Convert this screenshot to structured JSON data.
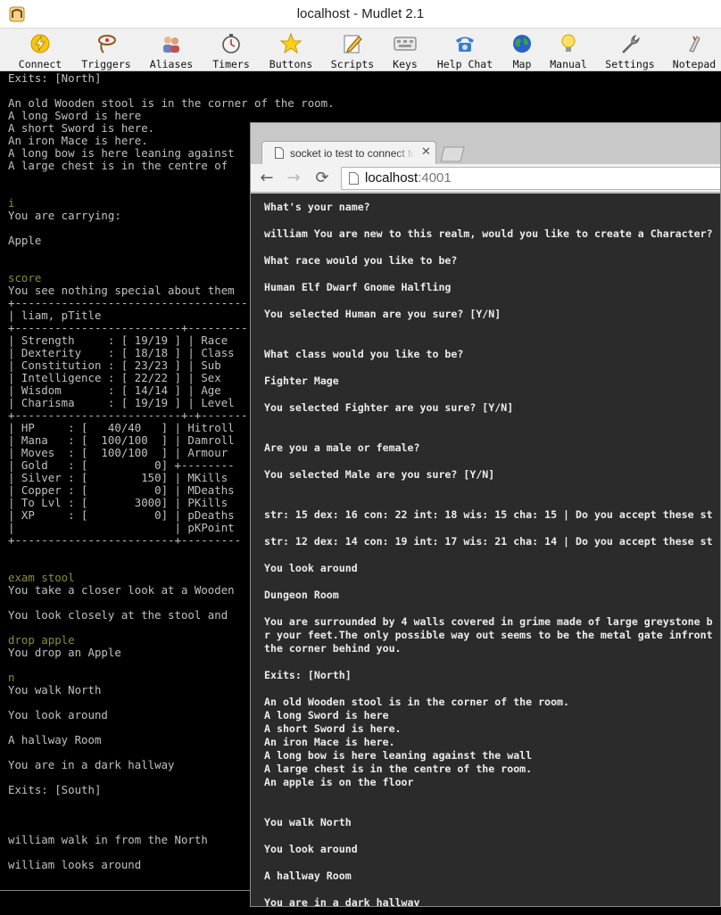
{
  "window": {
    "title": "localhost - Mudlet 2.1"
  },
  "toolbar": {
    "items": [
      {
        "label": "Connect",
        "icon": "lightning-icon"
      },
      {
        "label": "Triggers",
        "icon": "lasso-icon"
      },
      {
        "label": "Aliases",
        "icon": "people-icon"
      },
      {
        "label": "Timers",
        "icon": "stopwatch-icon"
      },
      {
        "label": "Buttons",
        "icon": "star-icon"
      },
      {
        "label": "Scripts",
        "icon": "pencil-icon"
      },
      {
        "label": "Keys",
        "icon": "keyboard-icon"
      },
      {
        "label": "Help Chat",
        "icon": "telephone-icon"
      },
      {
        "label": "Map",
        "icon": "globe-icon"
      },
      {
        "label": "Manual",
        "icon": "lightbulb-icon"
      },
      {
        "label": "Settings",
        "icon": "wrench-icon"
      },
      {
        "label": "Notepad",
        "icon": "notepad-icon"
      }
    ]
  },
  "console": {
    "lines": [
      {
        "text": "Exits: [North]",
        "kind": "out"
      },
      {
        "text": "An old Wooden stool is in the corner of the room.",
        "kind": "out"
      },
      {
        "text": "A long Sword is here",
        "kind": "out"
      },
      {
        "text": "A short Sword is here.",
        "kind": "out"
      },
      {
        "text": "An iron Mace is here.",
        "kind": "out"
      },
      {
        "text": "A long bow is here leaning against",
        "kind": "out"
      },
      {
        "text": "A large chest is in the centre of",
        "kind": "out"
      },
      {
        "text": "i",
        "kind": "cmd"
      },
      {
        "text": "You are carrying:",
        "kind": "out"
      },
      {
        "text": "Apple",
        "kind": "out"
      },
      {
        "text": "score",
        "kind": "cmd"
      },
      {
        "text": "You see nothing special about them",
        "kind": "out"
      },
      {
        "text": "+-----------------------------------",
        "kind": "out"
      },
      {
        "text": "| liam, pTitle",
        "kind": "out"
      },
      {
        "text": "+-------------------------+---------",
        "kind": "out"
      },
      {
        "text": "| Strength     : [ 19/19 ] | Race",
        "kind": "out"
      },
      {
        "text": "| Dexterity    : [ 18/18 ] | Class",
        "kind": "out"
      },
      {
        "text": "| Constitution : [ 23/23 ] | Sub",
        "kind": "out"
      },
      {
        "text": "| Intelligence : [ 22/22 ] | Sex",
        "kind": "out"
      },
      {
        "text": "| Wisdom       : [ 14/14 ] | Age",
        "kind": "out"
      },
      {
        "text": "| Charisma     : [ 19/19 ] | Level",
        "kind": "out"
      },
      {
        "text": "+-------------------------+-+-------",
        "kind": "out"
      },
      {
        "text": "| HP     : [   40/40   ] | Hitroll",
        "kind": "out"
      },
      {
        "text": "| Mana   : [  100/100  ] | Damroll",
        "kind": "out"
      },
      {
        "text": "| Moves  : [  100/100  ] | Armour",
        "kind": "out"
      },
      {
        "text": "| Gold   : [          0] +--------",
        "kind": "out"
      },
      {
        "text": "| Silver : [        150] | MKills",
        "kind": "out"
      },
      {
        "text": "| Copper : [          0] | MDeaths",
        "kind": "out"
      },
      {
        "text": "| To Lvl : [       3000] | PKills",
        "kind": "out"
      },
      {
        "text": "| XP     : [          0] | pDeaths",
        "kind": "out"
      },
      {
        "text": "|                        | pKPoint",
        "kind": "out"
      },
      {
        "text": "+------------------------+---------",
        "kind": "out"
      },
      {
        "text": "exam stool",
        "kind": "cmd"
      },
      {
        "text": "You take a closer look at a Wooden",
        "kind": "out"
      },
      {
        "text": "You look closely at the stool and",
        "kind": "out"
      },
      {
        "text": "drop apple",
        "kind": "cmd"
      },
      {
        "text": "You drop an Apple",
        "kind": "out"
      },
      {
        "text": "n",
        "kind": "cmd"
      },
      {
        "text": "You walk North",
        "kind": "out"
      },
      {
        "text": "You look around",
        "kind": "out"
      },
      {
        "text": "A hallway Room",
        "kind": "out"
      },
      {
        "text": "You are in a dark hallway",
        "kind": "out"
      },
      {
        "text": "Exits: [South]",
        "kind": "out"
      },
      {
        "text": "william walk in from the North",
        "kind": "out"
      },
      {
        "text": "william looks around",
        "kind": "out"
      }
    ]
  },
  "browser": {
    "tab_title": "socket io test to connect to",
    "tab_close": "✕",
    "url_host": "localhost",
    "url_port": ":4001",
    "back": "←",
    "forward": "→",
    "reload": "⟳",
    "page_lines": [
      "What's your name?",
      "william You are new to this realm, would you like to create a Character?",
      "What race would you like to be?",
      "Human Elf Dwarf Gnome Halfling",
      "You selected Human are you sure? [Y/N]",
      "What class would you like to be?",
      "Fighter Mage",
      "You selected Fighter are you sure? [Y/N]",
      "Are you a male or female?",
      "You selected Male are you sure? [Y/N]",
      "str: 15 dex: 16 con: 22 int: 18 wis: 15 cha: 15 | Do you accept these st",
      "str: 12 dex: 14 con: 19 int: 17 wis: 21 cha: 14 | Do you accept these st",
      "You look around",
      "Dungeon Room",
      "You are surrounded by 4 walls covered in grime made of large greystone b",
      "r your feet.The only possible way out seems to be the metal gate infront",
      "the corner behind you.",
      "Exits: [North]",
      "An old Wooden stool is in the corner of the room.",
      "A long Sword is here",
      "A short Sword is here.",
      "An iron Mace is here.",
      "A long bow is here leaning against the wall",
      "A large chest is in the centre of the room.",
      "An apple is on the floor",
      "You walk North",
      "You look around",
      "A hallway Room",
      "You are in a dark hallway"
    ]
  },
  "colors": {
    "console_bg": "#000000",
    "console_text": "#c0c0c0",
    "command_echo": "#8c8c3c",
    "page_bg": "#2b2b2b",
    "page_text": "#ececec"
  }
}
